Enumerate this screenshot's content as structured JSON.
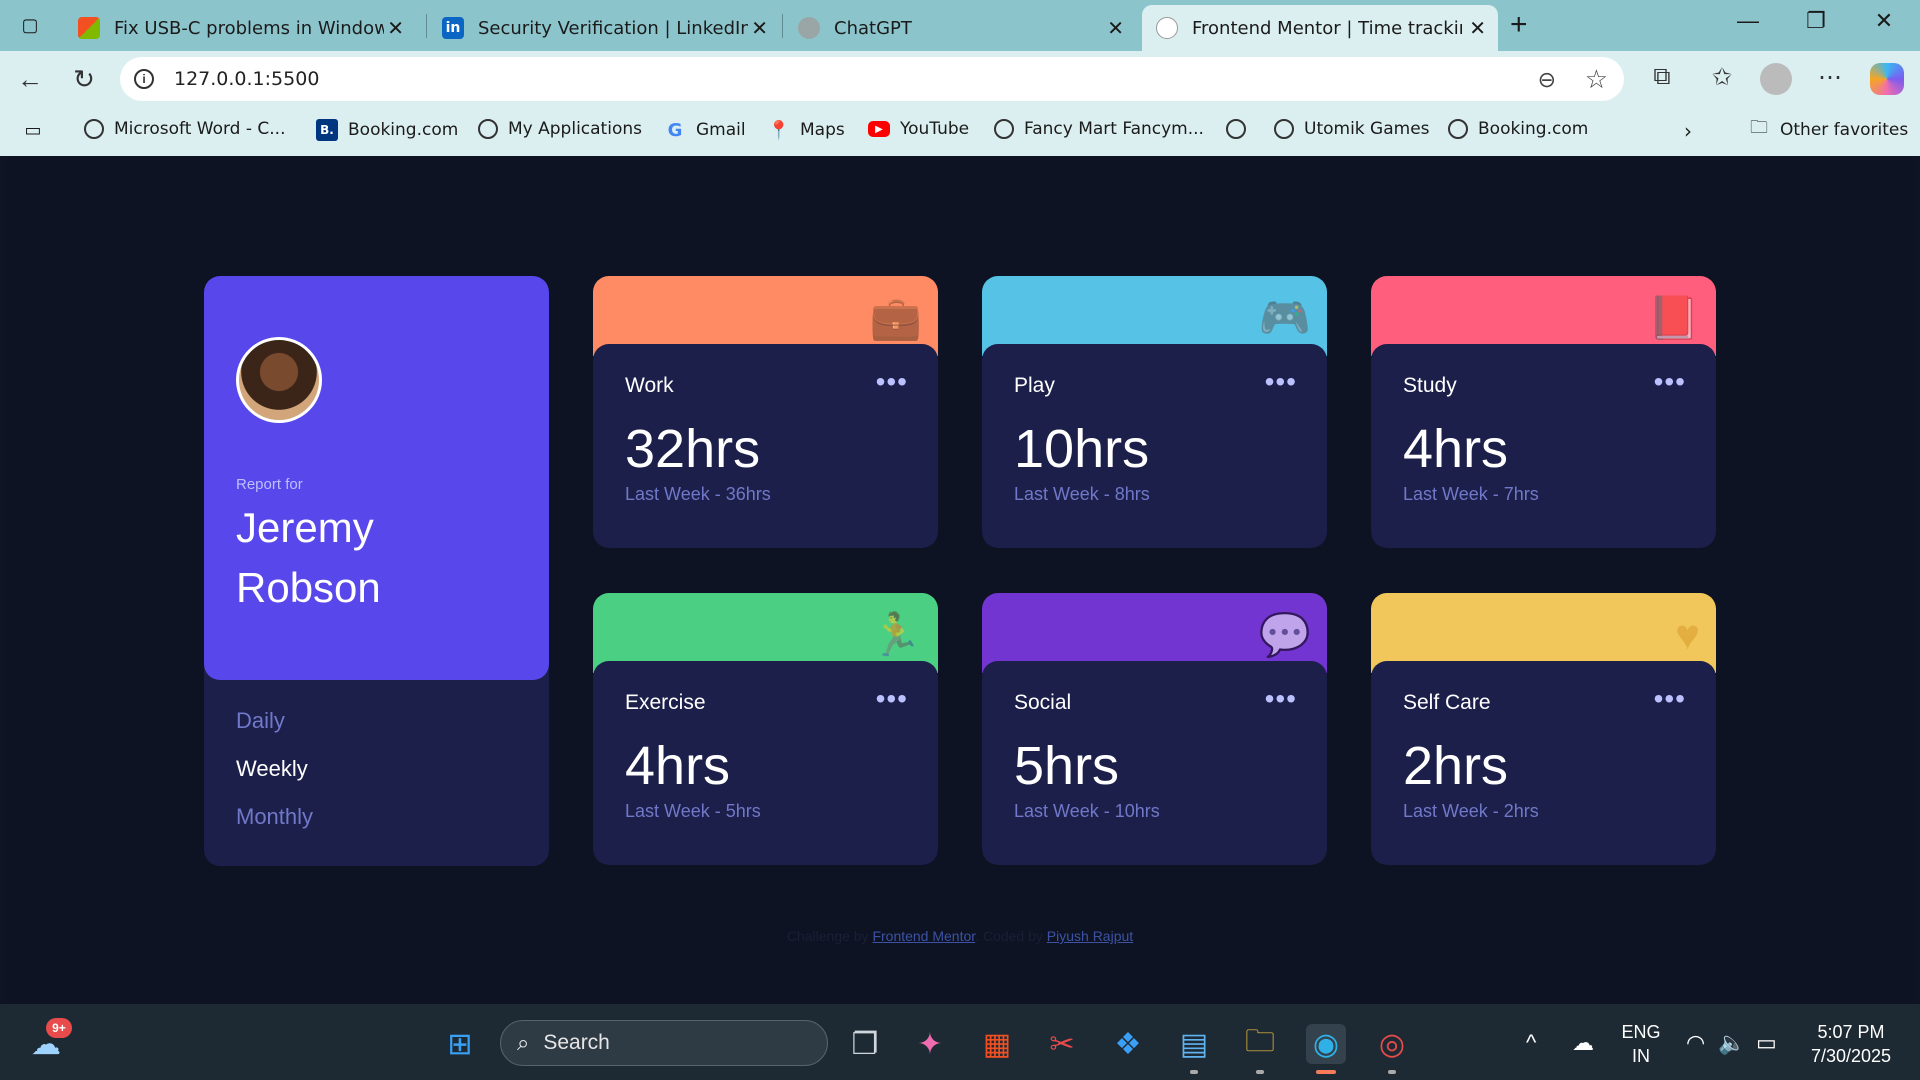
{
  "browser": {
    "tabs": [
      {
        "title": "Fix USB-C problems in Windows",
        "favicon_color": "#4a90d9"
      },
      {
        "title": "Security Verification | LinkedIn",
        "favicon_color": "#0a66c2",
        "favicon_text": "in"
      },
      {
        "title": "ChatGPT",
        "favicon_color": "#9aa5a6"
      },
      {
        "title": "Frontend Mentor | Time tracking",
        "favicon_color": "#e6e6e6"
      }
    ],
    "url": "127.0.0.1:5500",
    "bookmarks": [
      {
        "label": "Microsoft Word - C...",
        "icon": "globe-icon"
      },
      {
        "label": "Booking.com",
        "icon": "booking-icon",
        "icon_text": "B."
      },
      {
        "label": "My Applications",
        "icon": "globe-icon"
      },
      {
        "label": "Gmail",
        "icon": "google-icon",
        "icon_text": "G"
      },
      {
        "label": "Maps",
        "icon": "maps-icon"
      },
      {
        "label": "YouTube",
        "icon": "youtube-icon"
      },
      {
        "label": "Fancy Mart Fancym...",
        "icon": "globe-icon"
      },
      {
        "label": "",
        "icon": "globe-icon"
      },
      {
        "label": "Utomik Games",
        "icon": "globe-icon"
      },
      {
        "label": "Booking.com",
        "icon": "globe-icon"
      }
    ],
    "other_favorites": "Other favorites"
  },
  "dashboard": {
    "report_for": "Report for",
    "name": "Jeremy Robson",
    "periods": [
      "Daily",
      "Weekly",
      "Monthly"
    ],
    "selected_period": "Weekly",
    "cards": [
      {
        "title": "Work",
        "current": "32hrs",
        "previous": "Last Week - 36hrs",
        "color": "#ff8b64",
        "icon": "briefcase-icon"
      },
      {
        "title": "Play",
        "current": "10hrs",
        "previous": "Last Week - 8hrs",
        "color": "#55c2e6",
        "icon": "gamepad-icon"
      },
      {
        "title": "Study",
        "current": "4hrs",
        "previous": "Last Week - 7hrs",
        "color": "#ff5e7d",
        "icon": "book-icon"
      },
      {
        "title": "Exercise",
        "current": "4hrs",
        "previous": "Last Week - 5hrs",
        "color": "#4bcf82",
        "icon": "running-icon"
      },
      {
        "title": "Social",
        "current": "5hrs",
        "previous": "Last Week - 10hrs",
        "color": "#7335d2",
        "icon": "chat-icon"
      },
      {
        "title": "Self Care",
        "current": "2hrs",
        "previous": "Last Week - 2hrs",
        "color": "#f1c75b",
        "icon": "heart-icon"
      }
    ],
    "menu_glyph": "•••"
  },
  "attribution": {
    "prefix": "Challenge by",
    "link1": "Frontend Mentor",
    "middle": ". Coded by",
    "link2": "Piyush Rajput"
  },
  "taskbar": {
    "weather_badge": "9+",
    "search_placeholder": "Search",
    "lang_top": "ENG",
    "lang_bottom": "IN",
    "time": "5:07 PM",
    "date": "7/30/2025"
  }
}
